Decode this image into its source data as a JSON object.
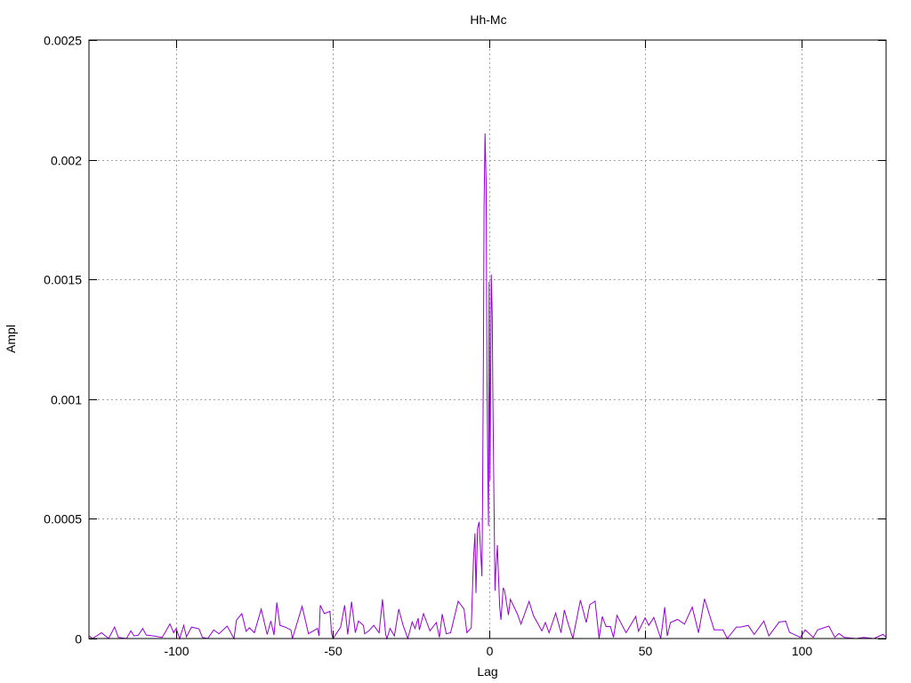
{
  "chart_data": {
    "type": "line",
    "title": "Hh-Mc",
    "xlabel": "Lag",
    "ylabel": "Ampl",
    "xlim": [
      -128,
      127
    ],
    "ylim": [
      0,
      0.0025
    ],
    "xticks": [
      -100,
      -50,
      0,
      50,
      100
    ],
    "xtick_labels": [
      "-100",
      "-50",
      "0",
      "50",
      "100"
    ],
    "yticks": [
      0,
      0.0005,
      0.001,
      0.0015,
      0.002,
      0.0025
    ],
    "ytick_labels": [
      "0",
      "0.0005",
      "0.001",
      "0.0015",
      "0.002",
      "0.0025"
    ],
    "grid": true,
    "legend": "none",
    "series": [
      {
        "name": "Hh-Mc",
        "color": "#9400d3",
        "points": [
          [
            -127.8,
            1e-05
          ],
          [
            -126.9,
            0
          ],
          [
            -124.0,
            2.4e-05
          ],
          [
            -121.7,
            0
          ],
          [
            -119.8,
            4.8e-05
          ],
          [
            -118.6,
            5e-06
          ],
          [
            -116.0,
            0
          ],
          [
            -114.6,
            3.2e-05
          ],
          [
            -113.6,
            1.1e-05
          ],
          [
            -112.2,
            1.4e-05
          ],
          [
            -110.8,
            4.2e-05
          ],
          [
            -109.7,
            1.5e-05
          ],
          [
            -107.0,
            1e-05
          ],
          [
            -104.6,
            5e-06
          ],
          [
            -103.7,
            2.4e-05
          ],
          [
            -102.1,
            6.1e-05
          ],
          [
            -100.9,
            2.4e-05
          ],
          [
            -100.1,
            4.2e-05
          ],
          [
            -99.0,
            0
          ],
          [
            -97.7,
            5.5e-05
          ],
          [
            -96.8,
            7e-06
          ],
          [
            -95.2,
            4.8e-05
          ],
          [
            -92.8,
            4e-05
          ],
          [
            -91.7,
            5e-06
          ],
          [
            -90.0,
            0
          ],
          [
            -88.1,
            3.6e-05
          ],
          [
            -86.4,
            2e-05
          ],
          [
            -83.8,
            5.2e-05
          ],
          [
            -81.6,
            0
          ],
          [
            -80.8,
            7.7e-05
          ],
          [
            -79.1,
            0.000104
          ],
          [
            -77.7,
            3e-05
          ],
          [
            -76.7,
            4.5e-05
          ],
          [
            -75.1,
            2.4e-05
          ],
          [
            -72.9,
            0.000123
          ],
          [
            -71.0,
            1.7e-05
          ],
          [
            -69.8,
            7.3e-05
          ],
          [
            -68.8,
            1.5e-05
          ],
          [
            -67.9,
            0.000151
          ],
          [
            -66.9,
            5.5e-05
          ],
          [
            -65.3,
            4.8e-05
          ],
          [
            -63.4,
            3.6e-05
          ],
          [
            -62.9,
            0
          ],
          [
            -59.8,
            0.000135
          ],
          [
            -57.8,
            2e-05
          ],
          [
            -54.9,
            4.2e-05
          ],
          [
            -54.4,
            1.1e-05
          ],
          [
            -54.0,
            0.000139
          ],
          [
            -52.7,
            0.000104
          ],
          [
            -50.9,
            0.000114
          ],
          [
            -50.4,
            2e-05
          ],
          [
            -49.9,
            0
          ],
          [
            -47.5,
            4.8e-05
          ],
          [
            -46.2,
            0.000139
          ],
          [
            -45.2,
            1.7e-05
          ],
          [
            -44.0,
            0.000154
          ],
          [
            -42.8,
            2.4e-05
          ],
          [
            -41.8,
            7.3e-05
          ],
          [
            -40.2,
            5.5e-05
          ],
          [
            -39.8,
            2e-05
          ],
          [
            -38.5,
            3.2e-05
          ],
          [
            -36.9,
            5.5e-05
          ],
          [
            -35.2,
            2.4e-05
          ],
          [
            -34.1,
            0.000164
          ],
          [
            -33.1,
            1.7e-05
          ],
          [
            -32.7,
            0
          ],
          [
            -31.7,
            4.2e-05
          ],
          [
            -30.3,
            1.1e-05
          ],
          [
            -28.9,
            0.000123
          ],
          [
            -27.5,
            5.5e-05
          ],
          [
            -26.0,
            0
          ],
          [
            -24.6,
            6.9e-05
          ],
          [
            -23.7,
            4.2e-05
          ],
          [
            -22.7,
            8.5e-05
          ],
          [
            -22.3,
            3.6e-05
          ],
          [
            -21.0,
            0.000104
          ],
          [
            -18.9,
            3.2e-05
          ],
          [
            -16.9,
            6.7e-05
          ],
          [
            -15.9,
            5e-06
          ],
          [
            -15.0,
            0.000102
          ],
          [
            -13.7,
            2e-05
          ],
          [
            -12.3,
            2.4e-05
          ],
          [
            -9.9,
            0.000156
          ],
          [
            -8.0,
            0.000123
          ],
          [
            -7.1,
            2.4e-05
          ],
          [
            -5.7,
            4.5e-05
          ],
          [
            -5.0,
            0.00033
          ],
          [
            -4.5,
            0.00044
          ],
          [
            -4.2,
            0.00019
          ],
          [
            -3.7,
            0.00046
          ],
          [
            -3.2,
            0.000487
          ],
          [
            -2.6,
            0.00034
          ],
          [
            -2.3,
            0.00026
          ],
          [
            -2.1,
            0.00057
          ],
          [
            -1.8,
            0.00119
          ],
          [
            -1.6,
            0.0018
          ],
          [
            -1.3,
            0.00211
          ],
          [
            -0.95,
            0.00191
          ],
          [
            -0.66,
            0.0011
          ],
          [
            -0.38,
            0.00067
          ],
          [
            -0.2,
            0.00047
          ],
          [
            0.0,
            0.00149
          ],
          [
            0.3,
            0.00066
          ],
          [
            0.7,
            0.00152
          ],
          [
            1.0,
            0.00135
          ],
          [
            1.2,
            0.00101
          ],
          [
            1.5,
            0.00066
          ],
          [
            1.9,
            0.0002
          ],
          [
            2.1,
            0.00027
          ],
          [
            2.65,
            0.00039
          ],
          [
            2.9,
            0.0003
          ],
          [
            3.4,
            0.00013
          ],
          [
            3.8,
            7.8e-05
          ],
          [
            4.5,
            0.00021
          ],
          [
            4.9,
            0.000204
          ],
          [
            6.2,
            9.8e-05
          ],
          [
            6.8,
            0.000164
          ],
          [
            9.0,
            0.000104
          ],
          [
            10.2,
            6e-05
          ],
          [
            12.8,
            0.000155
          ],
          [
            14.2,
            9.5e-05
          ],
          [
            16.9,
            3.2e-05
          ],
          [
            18.0,
            6.7e-05
          ],
          [
            19.2,
            2.4e-05
          ],
          [
            21.3,
            0.000106
          ],
          [
            23.0,
            2.4e-05
          ],
          [
            24.1,
            0.000119
          ],
          [
            25.1,
            7e-05
          ],
          [
            26.8,
            0
          ],
          [
            29.2,
            0.00016
          ],
          [
            31.1,
            6.7e-05
          ],
          [
            32.2,
            0.000141
          ],
          [
            33.9,
            0.000156
          ],
          [
            35.2,
            0
          ],
          [
            36.2,
            9.2e-05
          ],
          [
            37.4,
            5e-05
          ],
          [
            38.8,
            5e-05
          ],
          [
            39.8,
            5e-06
          ],
          [
            40.9,
            9.7e-05
          ],
          [
            43.8,
            2.4e-05
          ],
          [
            46.9,
            9.2e-05
          ],
          [
            47.8,
            3e-05
          ],
          [
            49.9,
            8.6e-05
          ],
          [
            51.1,
            5.5e-05
          ],
          [
            52.7,
            8.8e-05
          ],
          [
            54.9,
            0
          ],
          [
            56.2,
            0.000131
          ],
          [
            57.0,
            1.1e-05
          ],
          [
            58.0,
            6.7e-05
          ],
          [
            60.3,
            8e-05
          ],
          [
            62.5,
            6e-05
          ],
          [
            65.0,
            0.000131
          ],
          [
            67.0,
            2.4e-05
          ],
          [
            68.9,
            0.000166
          ],
          [
            72.0,
            3.6e-05
          ],
          [
            74.8,
            3.6e-05
          ],
          [
            76.2,
            0
          ],
          [
            79.1,
            4.8e-05
          ],
          [
            80.5,
            4.8e-05
          ],
          [
            82.9,
            5.5e-05
          ],
          [
            84.8,
            1.7e-05
          ],
          [
            87.9,
            7.3e-05
          ],
          [
            89.5,
            1.1e-05
          ],
          [
            92.8,
            6.9e-05
          ],
          [
            94.9,
            7.2e-05
          ],
          [
            96.1,
            2.6e-05
          ],
          [
            99.6,
            5e-06
          ],
          [
            101.1,
            3.6e-05
          ],
          [
            103.7,
            5e-06
          ],
          [
            105.1,
            3.6e-05
          ],
          [
            108.7,
            5.2e-05
          ],
          [
            110.6,
            5e-06
          ],
          [
            111.9,
            2.1e-05
          ],
          [
            113.6,
            5e-06
          ],
          [
            117.4,
            0
          ],
          [
            119.8,
            5e-06
          ],
          [
            123.1,
            0
          ],
          [
            126.0,
            1.7e-05
          ],
          [
            126.9,
            7e-06
          ]
        ]
      }
    ]
  }
}
